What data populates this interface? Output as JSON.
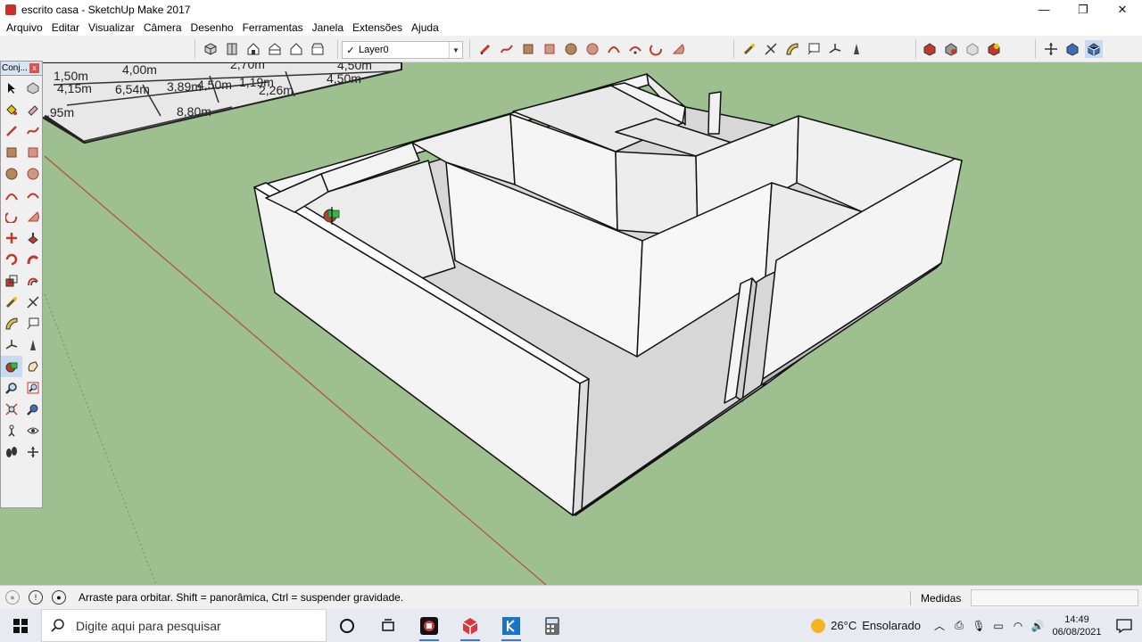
{
  "window": {
    "title": "escrito casa - SketchUp Make 2017",
    "controls": {
      "minimize": "—",
      "maximize": "❐",
      "close": "✕"
    }
  },
  "menu": [
    "Arquivo",
    "Editar",
    "Visualizar",
    "Câmera",
    "Desenho",
    "Ferramentas",
    "Janela",
    "Extensões",
    "Ajuda"
  ],
  "toolbar": {
    "layer_check": "✓",
    "layer_value": "Layer0",
    "view_icons": [
      "iso-view-icon",
      "top-view-icon",
      "front-view-icon",
      "right-view-icon",
      "back-view-icon",
      "left-view-icon"
    ],
    "draw_icons": [
      "pencil-icon",
      "freehand-icon",
      "rectangle-icon",
      "rotated-rectangle-icon",
      "circle-icon",
      "polygon-icon",
      "arc-icon",
      "two-point-arc-icon",
      "three-point-arc-icon",
      "pie-icon"
    ],
    "construction_icons": [
      "tape-measure-icon",
      "dimension-icon",
      "protractor-icon",
      "text-icon",
      "axes-icon",
      "3d-text-icon"
    ],
    "warehouse_icons": [
      "3d-warehouse-icon",
      "share-model-icon",
      "extension-warehouse-icon",
      "sketchup-ruby-icon"
    ],
    "section_icons": [
      "section-plane-icon",
      "display-section-icon",
      "section-cut-icon"
    ]
  },
  "palette": {
    "title": "Conj...",
    "close": "x",
    "tools": [
      "select-icon",
      "make-component-icon",
      "paint-bucket-icon",
      "eraser-icon",
      "line-icon",
      "freehand-icon",
      "rectangle-icon",
      "rotated-rectangle-icon",
      "circle-icon",
      "polygon-icon",
      "arc-icon",
      "two-point-arc-icon",
      "three-point-arc-icon",
      "pie-icon",
      "move-icon",
      "push-pull-icon",
      "rotate-icon",
      "follow-me-icon",
      "scale-icon",
      "offset-icon",
      "tape-measure-icon",
      "dimension-icon",
      "protractor-icon",
      "text-icon",
      "axes-icon",
      "3d-text-icon",
      "orbit-icon",
      "pan-icon",
      "zoom-icon",
      "zoom-window-icon",
      "zoom-extents-icon",
      "previous-view-icon",
      "position-camera-icon",
      "look-around-icon",
      "walk-icon",
      "section-plane-icon"
    ],
    "active_tool": "orbit-icon"
  },
  "viewport": {
    "dimensions": [
      "1,50m",
      "4,00m",
      "4,15m",
      "6,54m",
      "3,89m",
      "4,50m",
      "1,19m",
      "2,26m",
      "2,70m",
      "4,50m",
      "4,50m",
      "8,80m",
      ",95m"
    ]
  },
  "status": {
    "message": "Arraste para orbitar. Shift = panorâmica, Ctrl = suspender gravidade.",
    "measures_label": "Medidas",
    "measures_value": ""
  },
  "taskbar": {
    "search_placeholder": "Digite aqui para pesquisar",
    "weather_temp": "26°C",
    "weather_desc": "Ensolarado",
    "time": "14:49",
    "date": "06/08/2021",
    "apps": [
      "task-view-icon",
      "cortana-icon",
      "screen-recorder-icon",
      "sketchup-icon",
      "app-k-icon",
      "calculator-icon"
    ]
  }
}
